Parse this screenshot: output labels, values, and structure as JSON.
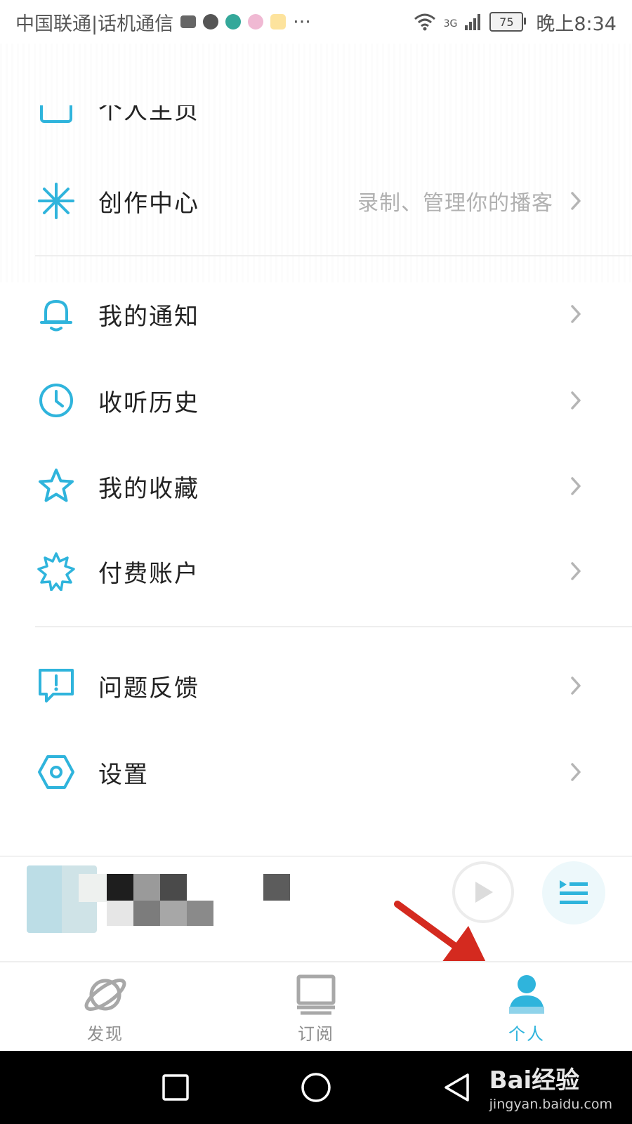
{
  "status_bar": {
    "carrier": "中国联通|话机通信",
    "more": "···",
    "network": "3G",
    "battery": "75",
    "time": "晚上8:34"
  },
  "menu": {
    "partial_row_label": "个人主页",
    "create_center": {
      "label": "创作中心",
      "hint": "录制、管理你的播客",
      "icon": "asterisk-icon"
    },
    "notifications": {
      "label": "我的通知",
      "icon": "bell-icon"
    },
    "history": {
      "label": "收听历史",
      "icon": "clock-icon"
    },
    "favorites": {
      "label": "我的收藏",
      "icon": "star-icon"
    },
    "paid_account": {
      "label": "付费账户",
      "icon": "badge-star-icon"
    },
    "feedback": {
      "label": "问题反馈",
      "icon": "feedback-icon"
    },
    "settings": {
      "label": "设置",
      "icon": "hexagon-settings-icon"
    }
  },
  "tabs": [
    {
      "label": "发现",
      "icon": "planet-icon",
      "active": false
    },
    {
      "label": "订阅",
      "icon": "monitor-icon",
      "active": false
    },
    {
      "label": "个人",
      "icon": "person-icon",
      "active": true
    }
  ],
  "watermark": {
    "brand": "Bai经验",
    "url": "jingyan.baidu.com"
  },
  "colors": {
    "accent": "#2fb4dc",
    "inactive": "#a8a8a8",
    "annotation_arrow": "#d42a1f"
  }
}
